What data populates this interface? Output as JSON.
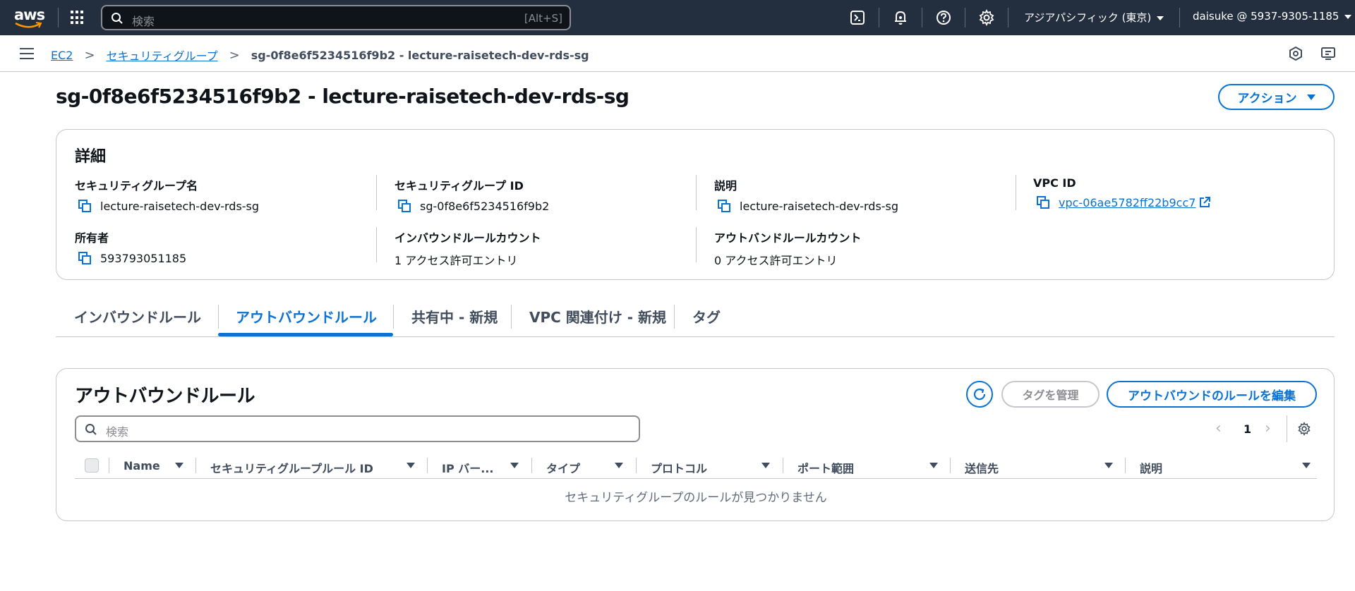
{
  "topbar": {
    "logo_text": "aws",
    "search_placeholder": "検索",
    "search_shortcut": "[Alt+S]",
    "icons": [
      "cloudshell-icon",
      "bell-icon",
      "help-icon",
      "gear-icon"
    ],
    "region": "アジアパシフィック (東京)",
    "account": "daisuke @ 5937-9305-1185"
  },
  "breadcrumb": {
    "items": [
      "EC2",
      "セキュリティグループ"
    ],
    "current": "sg-0f8e6f5234516f9b2 - lecture-raisetech-dev-rds-sg",
    "separator": ">"
  },
  "page": {
    "title": "sg-0f8e6f5234516f9b2 - lecture-raisetech-dev-rds-sg",
    "actions_label": "アクション"
  },
  "details": {
    "heading": "詳細",
    "fields": [
      {
        "label": "セキュリティグループ名",
        "value": "lecture-raisetech-dev-rds-sg"
      },
      {
        "label": "セキュリティグループ ID",
        "value": "sg-0f8e6f5234516f9b2"
      },
      {
        "label": "説明",
        "value": "lecture-raisetech-dev-rds-sg"
      },
      {
        "label": "VPC ID",
        "value": "vpc-06ae5782ff22b9cc7"
      },
      {
        "label": "所有者",
        "value": "593793051185"
      },
      {
        "label": "インバウンドルールカウント",
        "value": "1 アクセス許可エントリ"
      },
      {
        "label": "アウトバンドルールカウント",
        "value": "0 アクセス許可エントリ"
      }
    ]
  },
  "tabs": [
    {
      "label": "インバウンドルール",
      "active": false
    },
    {
      "label": "アウトバウンドルール",
      "active": true
    },
    {
      "label": "共有中 - 新規",
      "active": false
    },
    {
      "label": "VPC 関連付け - 新規",
      "active": false
    },
    {
      "label": "タグ",
      "active": false
    }
  ],
  "rules": {
    "heading": "アウトバウンドルール",
    "manage_tags_label": "タグを管理",
    "edit_label": "アウトバウンドのルールを編集",
    "search_placeholder": "検索",
    "page_number": "1",
    "columns": [
      "Name",
      "セキュリティグループルール ID",
      "IP バー...",
      "タイプ",
      "プロトコル",
      "ポート範囲",
      "送信先",
      "説明"
    ],
    "empty_text": "セキュリティグループのルールが見つかりません"
  },
  "colors": {
    "topbar_bg": "#232f3e",
    "link_blue": "#0972d3",
    "border": "#c6c6cd"
  }
}
